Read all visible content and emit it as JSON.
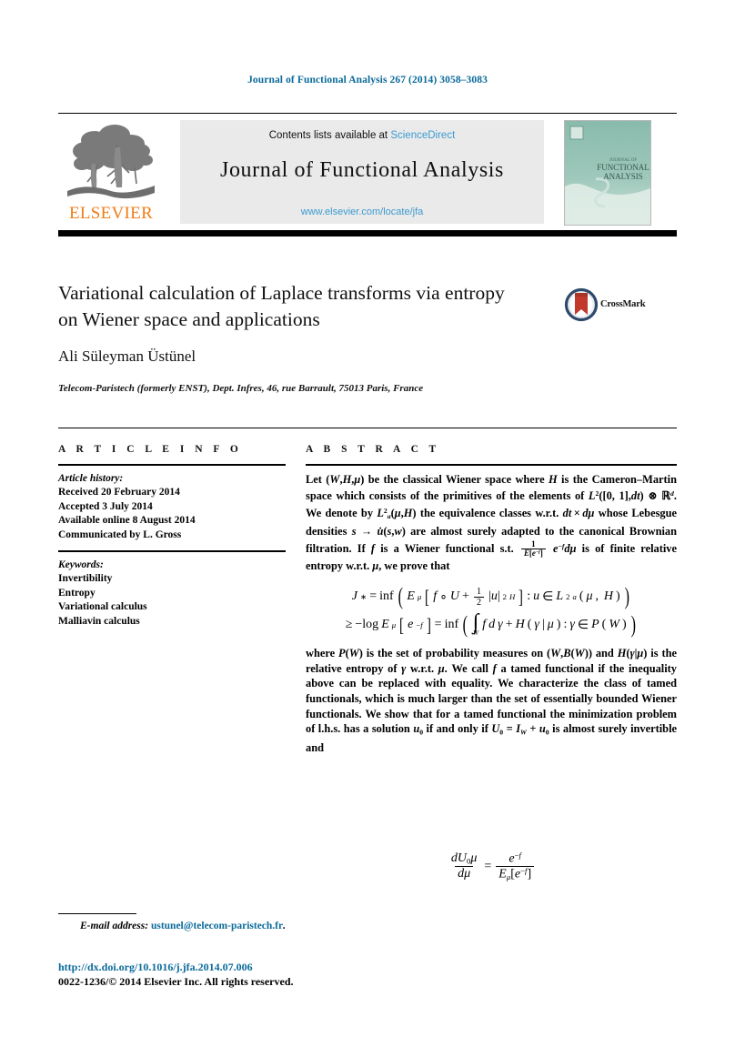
{
  "running_head": "Journal of Functional Analysis 267 (2014) 3058–3083",
  "masthead": {
    "publisher_wordmark": "ELSEVIER",
    "contents_prefix": "Contents lists available at",
    "contents_link": "ScienceDirect",
    "journal_name": "Journal of Functional Analysis",
    "journal_url": "www.elsevier.com/locate/jfa",
    "cover_title_line1": "JOURNAL OF",
    "cover_title_line2": "FUNCTIONAL",
    "cover_title_line3": "ANALYSIS"
  },
  "article": {
    "title": "Variational calculation of Laplace transforms via entropy on Wiener space and applications",
    "crossmark_label": "CrossMark",
    "author": "Ali Süleyman Üstünel",
    "affiliation": "Telecom-Paristech (formerly ENST), Dept. Infres, 46, rue Barrault, 75013 Paris, France"
  },
  "info": {
    "heading": "A R T I C L E   I N F O",
    "history_label": "Article history:",
    "history": [
      "Received 20 February 2014",
      "Accepted 3 July 2014",
      "Available online 8 August 2014",
      "Communicated by L. Gross"
    ],
    "keywords_label": "Keywords:",
    "keywords": [
      "Invertibility",
      "Entropy",
      "Variational calculus",
      "Malliavin calculus"
    ]
  },
  "abstract": {
    "heading": "A B S T R A C T",
    "paragraph_1_html": "Let (<i class=\"m\">W</i>,<i class=\"m\">H</i>,<i class=\"m\">μ</i>) be the classical Wiener space where <i class=\"m\">H</i> is the Cameron–Martin space which consists of the primitives of the elements of <i class=\"m\">L</i><span class=\"sup\">2</span>([0,&nbsp;1],<i class=\"m\">dt</i>) ⊗ ℝ<span class=\"sup\"><i class=\"m\">d</i></span>. We denote by <i class=\"m\">L</i><span class=\"sup\">2</span><span class=\"sub\"><i class=\"m\">a</i></span>(<i class=\"m\">μ</i>,<i class=\"m\">H</i>) the equivalence classes w.r.t. <i class=\"m\">dt</i>&thinsp;×&thinsp;<i class=\"m\">dμ</i> whose Lebesgue densities <i class=\"m\">s</i> → <i class=\"m\">u̇</i>(<i class=\"m\">s</i>,<i class=\"m\">w</i>) are almost surely adapted to the canonical Brownian filtration. If <i class=\"m\">f</i> is a Wiener functional s.t. FRAC1 <i class=\"m\">e</i><span class=\"sup\">−<i class=\"m\">f</i></span><i class=\"m\">dμ</i> is of finite relative entropy w.r.t. <i class=\"m\">μ</i>, we prove that",
    "paragraph_2_html": "where <i class=\"m\">P</i>(<i class=\"m\">W</i>) is the set of probability measures on (<i class=\"m\">W</i>,<i class=\"m\">B</i>(<i class=\"m\">W</i>)) and <i class=\"m\">H</i>(<i class=\"m\">γ</i>|<i class=\"m\">μ</i>) is the relative entropy of <i class=\"m\">γ</i> w.r.t. <i class=\"m\">μ</i>. We call <i class=\"m\">f</i> a tamed functional if the inequality above can be replaced with equality. We characterize the class of tamed functionals, which is much larger than the set of essentially bounded Wiener functionals. We show that for a tamed functional the minimization problem of l.h.s. has a solution <i class=\"m\">u</i><span class=\"sub\">0</span> if and only if <i class=\"m\">U</i><span class=\"sub\">0</span> = <i class=\"m\">I</i><span class=\"sub\"><i class=\"m\">W</i></span> + <i class=\"m\">u</i><span class=\"sub\">0</span> is almost surely invertible and",
    "inline_fraction": {
      "numerator": "1",
      "denominator": "E[e−f]"
    },
    "equation_1_plain": "J* = inf( Eμ[ f ∘ U + (1/2)|u|²H ] : u ∈ L²a(μ,H) )",
    "equation_2_plain": "≥ −log Eμ[e−f] = inf( ∫W f dγ + H(γ|μ) : γ ∈ P(W) )",
    "equation_3_plain": "dU0μ / dμ = e−f / Eμ[e−f]"
  },
  "footer": {
    "email_label": "E-mail address:",
    "email": "ustunel@telecom-paristech.fr",
    "email_trailing": ".",
    "doi": "http://dx.doi.org/10.1016/j.jfa.2014.07.006",
    "copyright": "0022-1236/© 2014 Elsevier Inc. All rights reserved."
  },
  "colors": {
    "link_blue": "#0b6a9b",
    "sciencedirect_blue": "#3c9bd0",
    "elsevier_orange": "#f07c16",
    "cover_teal": "#7fb3a4",
    "crossmark_red": "#c0392b",
    "crossmark_blue": "#2e4a6b"
  }
}
